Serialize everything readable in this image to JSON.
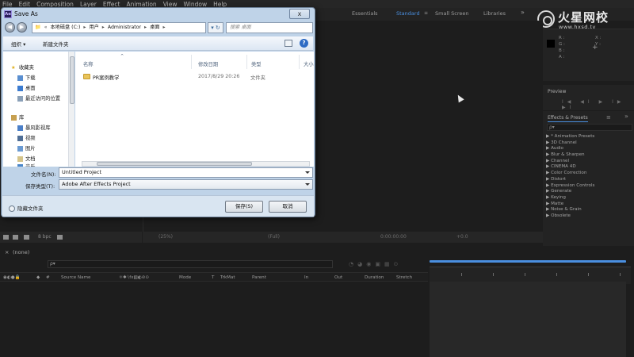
{
  "menubar": {
    "items": [
      "File",
      "Edit",
      "Composition",
      "Layer",
      "Effect",
      "Animation",
      "View",
      "Window",
      "Help"
    ]
  },
  "workspaces": {
    "items": [
      "Essentials",
      "Standard",
      "Small Screen",
      "Libraries"
    ],
    "active": "Standard",
    "menu_icon": "≡",
    "more_icon": "»"
  },
  "watermark": {
    "brand": "火星网校",
    "url": "www.hxsd.tv"
  },
  "info_panel": {
    "r": "R :",
    "g": "G :",
    "b": "B :",
    "a": "A :",
    "x": "X :",
    "y": "Y :"
  },
  "preview_panel": {
    "title": "Preview",
    "controls": "I◀ ◀I ▶ I▶ ▶I"
  },
  "effects_panel": {
    "title": "Effects & Presets",
    "search_placeholder": "ρ▾",
    "items": [
      "▶ * Animation Presets",
      "▶ 3D Channel",
      "▶ Audio",
      "▶ Blur & Sharpen",
      "▶ Channel",
      "▶ CINEMA 4D",
      "▶ Color Correction",
      "▶ Distort",
      "▶ Expression Controls",
      "▶ Generate",
      "▶ Keying",
      "▶ Matte",
      "▶ Noise & Grain",
      "▶ Obsolete"
    ]
  },
  "project_footer": {
    "bpc": "8 bpc"
  },
  "comp_footer": {
    "zoom": "(25%)",
    "res": "(Full)",
    "time": "0:00:00:00",
    "offset": "+0.0"
  },
  "timeline": {
    "tab_label": "(none)",
    "search_placeholder": "ρ▾",
    "columns": {
      "source_name": "Source Name",
      "mode": "Mode",
      "t": "T",
      "trkmat": "TrkMat",
      "parent": "Parent",
      "in": "In",
      "out": "Out",
      "duration": "Duration",
      "stretch": "Stretch",
      "hash": "#",
      "switches": "⚛✱∖fx▧◐⊘⊙"
    }
  },
  "dialog": {
    "title": "Save As",
    "app_icon": "Ae",
    "close_label": "x",
    "back_icon": "◀",
    "forward_icon": "▶",
    "path": [
      "本地磁盘 (C:)",
      "用户",
      "Administrator",
      "桌面"
    ],
    "search_placeholder": "搜索 桌面",
    "toolbar": {
      "organize": "组织 ▾",
      "new_folder": "新建文件夹"
    },
    "nav": {
      "favorites": "收藏夹",
      "favorites_items": [
        "下载",
        "桌面",
        "最近访问的位置"
      ],
      "library": "库",
      "library_items": [
        "暴风影视库",
        "视频",
        "图片",
        "文档",
        "音乐"
      ]
    },
    "columns": {
      "name": "名称",
      "date": "修改日期",
      "type": "类型",
      "size": "大小"
    },
    "files": [
      {
        "name": "PR案例教学",
        "date": "2017/8/29 20:26",
        "type": "文件夹"
      }
    ],
    "filename_label": "文件名(N):",
    "filename_value": "Untitled Project",
    "savetype_label": "保存类型(T):",
    "savetype_value": "Adobe After Effects Project",
    "hide_folders": "隐藏文件夹",
    "save_button": "保存(S)",
    "cancel_button": "取消"
  }
}
